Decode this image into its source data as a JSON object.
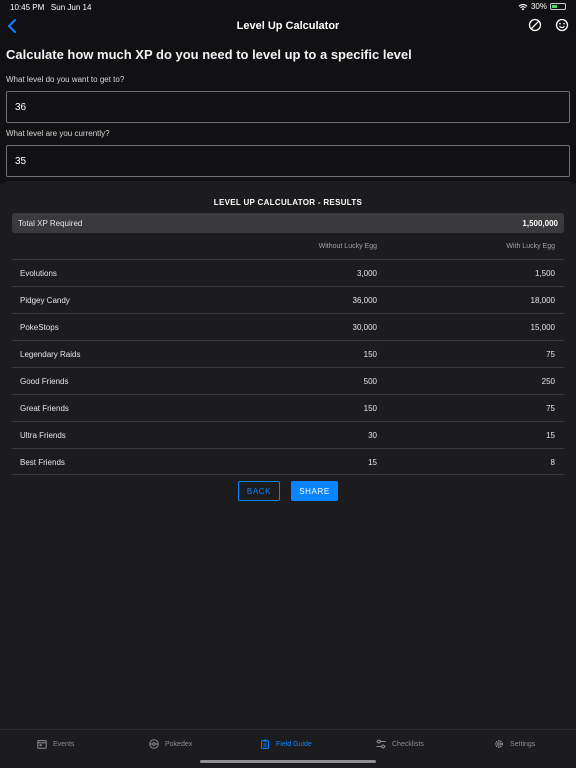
{
  "status": {
    "time": "10:45 PM",
    "date": "Sun Jun 14",
    "battery": "30%"
  },
  "nav": {
    "title": "Level Up Calculator"
  },
  "heading": "Calculate how much XP do you need to level up to a specific level",
  "form": {
    "target_label": "What level do you want to get to?",
    "target_value": "36",
    "current_label": "What level are you currently?",
    "current_value": "35"
  },
  "results": {
    "title": "LEVEL UP CALCULATOR - RESULTS",
    "total_label": "Total XP Required",
    "total_value": "1,500,000",
    "col_without": "Without Lucky Egg",
    "col_with": "With Lucky Egg",
    "rows": [
      {
        "name": "Evolutions",
        "without": "3,000",
        "with": "1,500"
      },
      {
        "name": "Pidgey Candy",
        "without": "36,000",
        "with": "18,000"
      },
      {
        "name": "PokeStops",
        "without": "30,000",
        "with": "15,000"
      },
      {
        "name": "Legendary Raids",
        "without": "150",
        "with": "75"
      },
      {
        "name": "Good Friends",
        "without": "500",
        "with": "250"
      },
      {
        "name": "Great Friends",
        "without": "150",
        "with": "75"
      },
      {
        "name": "Ultra Friends",
        "without": "30",
        "with": "15"
      },
      {
        "name": "Best Friends",
        "without": "15",
        "with": "8"
      }
    ]
  },
  "buttons": {
    "back": "BACK",
    "share": "SHARE"
  },
  "tabs": [
    {
      "label": "Events",
      "icon": "calendar-icon"
    },
    {
      "label": "Pokedex",
      "icon": "pokeball-icon"
    },
    {
      "label": "Field Guide",
      "icon": "clipboard-icon"
    },
    {
      "label": "Checklists",
      "icon": "sliders-icon"
    },
    {
      "label": "Settings",
      "icon": "gear-icon"
    }
  ],
  "colors": {
    "accent": "#0a84ff",
    "background": "#1c1c1e",
    "header": "#111113"
  }
}
